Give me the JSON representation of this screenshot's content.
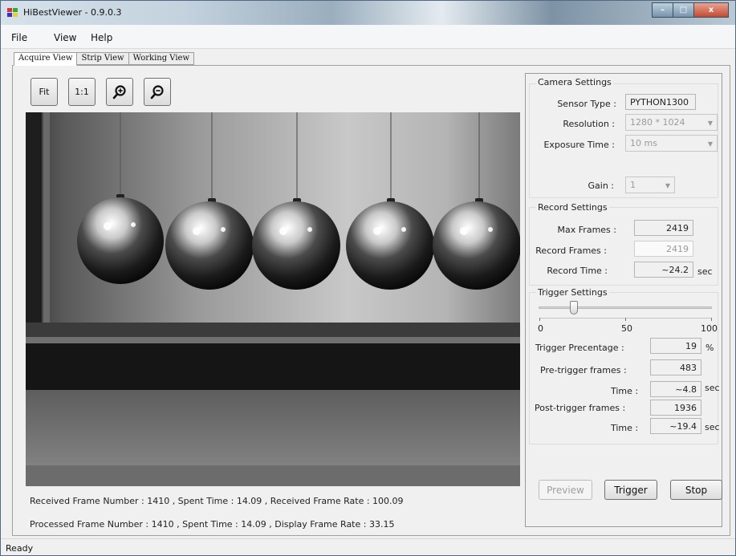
{
  "window": {
    "title": "HiBestViewer - 0.9.0.3",
    "minimize": "–",
    "maximize": "□",
    "close": "x"
  },
  "menu": [
    "File",
    "View",
    "Help"
  ],
  "tabs": [
    "Acquire View",
    "Strip View",
    "Working View"
  ],
  "zoom_toolbar": {
    "fit_label": "Fit",
    "one_to_one_label": "1:1",
    "zoom_in_icon": "zoom-in-icon",
    "zoom_out_icon": "zoom-out-icon"
  },
  "info": {
    "received": "Received Frame Number : 1410 , Spent Time : 14.09 , Received Frame Rate : 100.09",
    "processed": "Processed Frame Number : 1410 , Spent Time : 14.09 ,  Display Frame Rate : 33.15"
  },
  "camera_settings": {
    "title": "Camera Settings",
    "sensor_type_label": "Sensor Type :",
    "sensor_type_value": "PYTHON1300",
    "resolution_label": "Resolution :",
    "resolution_value": "1280 * 1024",
    "exposure_label": "Exposure Time :",
    "exposure_value": "10 ms",
    "gain_label": "Gain :",
    "gain_value": "1"
  },
  "record_settings": {
    "title": "Record Settings",
    "max_frames_label": "Max Frames :",
    "max_frames_value": "2419",
    "record_frames_label": "Record Frames :",
    "record_frames_value": "2419",
    "record_time_label": "Record Time :",
    "record_time_value": "~24.2",
    "record_time_unit": "sec"
  },
  "trigger_settings": {
    "title": "Trigger Settings",
    "slider_percent": 19,
    "scale_min": "0",
    "scale_mid": "50",
    "scale_max": "100",
    "percentage_label": "Trigger Precentage :",
    "percentage_value": "19",
    "percentage_unit": "%",
    "pre_frames_label": "Pre-trigger frames :",
    "pre_frames_value": "483",
    "pre_time_label": "Time :",
    "pre_time_value": "~4.8",
    "pre_time_unit": "sec",
    "post_frames_label": "Post-trigger frames :",
    "post_frames_value": "1936",
    "post_time_label": "Time :",
    "post_time_value": "~19.4",
    "post_time_unit": "sec"
  },
  "actions": {
    "preview": "Preview",
    "trigger": "Trigger",
    "stop": "Stop"
  },
  "status": "Ready"
}
